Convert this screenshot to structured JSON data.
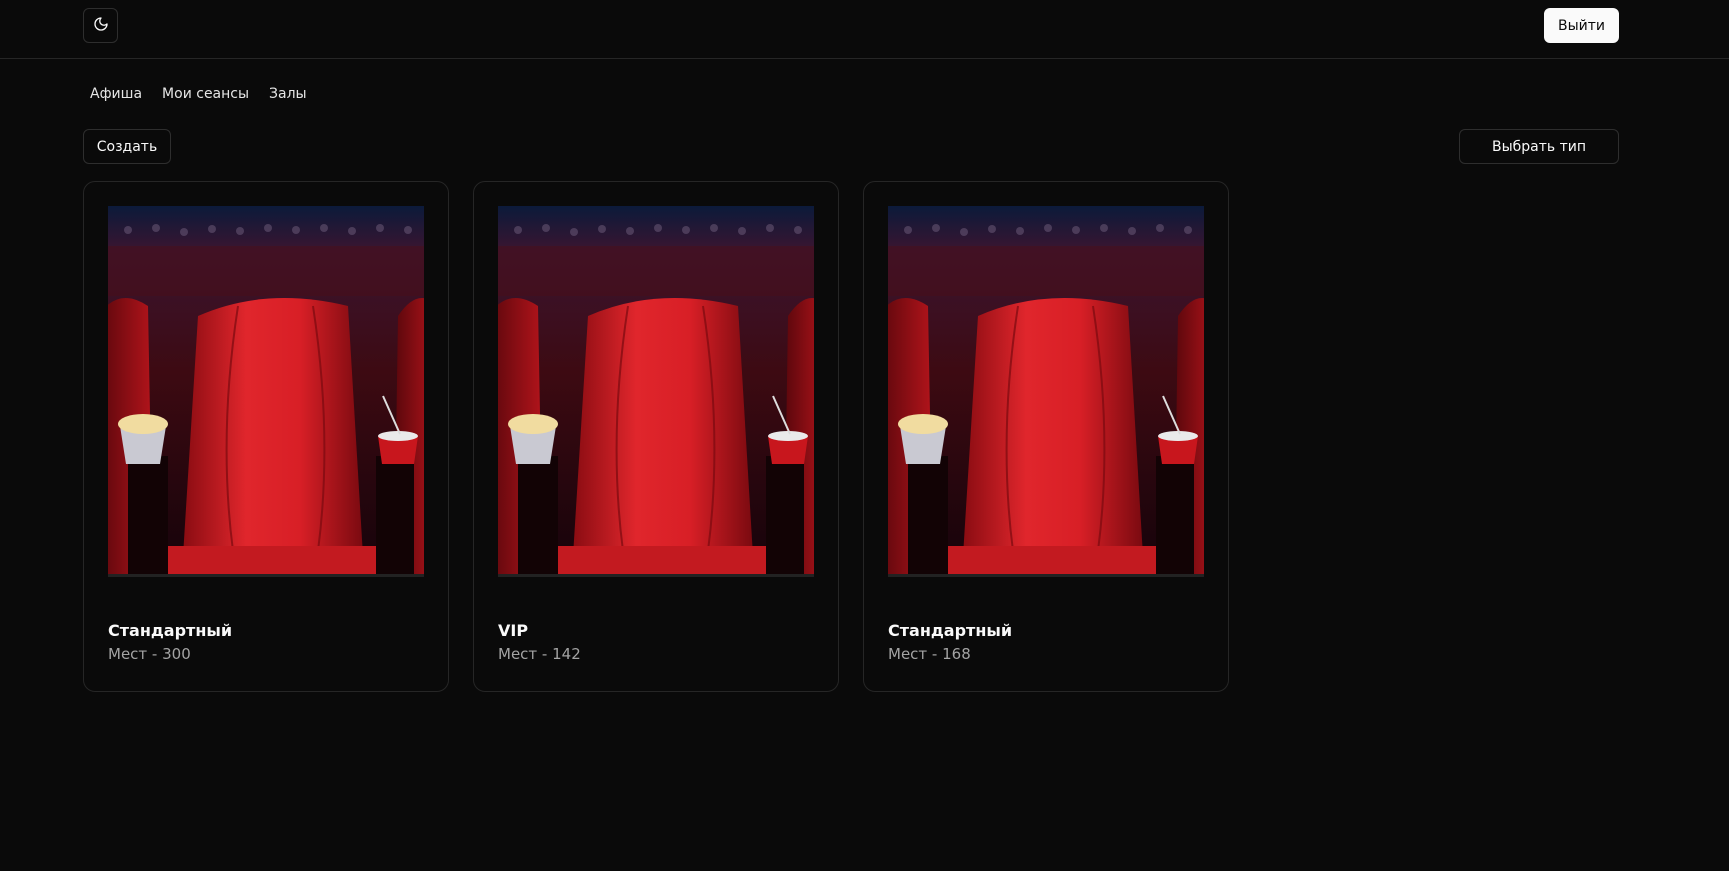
{
  "header": {
    "theme_icon": "moon-icon",
    "logout_label": "Выйти"
  },
  "nav": {
    "items": [
      {
        "label": "Афиша"
      },
      {
        "label": "Мои сеансы"
      },
      {
        "label": "Залы"
      }
    ]
  },
  "toolbar": {
    "create_label": "Создать",
    "select_type_label": "Выбрать тип"
  },
  "halls": [
    {
      "title": "Стандартный",
      "seats": "Мест - 300",
      "image": "cinema-seat-image"
    },
    {
      "title": "VIP",
      "seats": "Мест - 142",
      "image": "cinema-seat-image"
    },
    {
      "title": "Стандартный",
      "seats": "Мест - 168",
      "image": "cinema-seat-image"
    }
  ],
  "colors": {
    "background": "#0a0a0a",
    "border": "#262626",
    "seat_red": "#c8161d",
    "muted_text": "#a3a3a3"
  }
}
